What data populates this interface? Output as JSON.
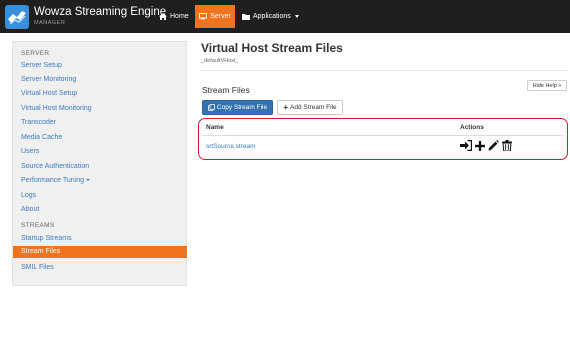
{
  "navbar": {
    "brand_title": "Wowza Streaming Engine",
    "brand_subtitle": "MANAGER",
    "home_label": "Home",
    "server_label": "Server",
    "applications_label": "Applications",
    "active_color": "#f0731f",
    "background_color": "#1f1f1f"
  },
  "sidebar": {
    "server_heading": "SERVER",
    "server_items": [
      "Server Setup",
      "Server Monitoring",
      "Virtual Host Setup",
      "Virtual Host Monitoring",
      "Transcoder",
      "Media Cache",
      "Users",
      "Source Authentication",
      "Performance Tuning",
      "Logs",
      "About"
    ],
    "streams_heading": "STREAMS",
    "streams_items": [
      "Startup Streams",
      "Stream Files",
      "SMIL Files"
    ],
    "active_item": "Stream Files"
  },
  "main": {
    "page_title": "Virtual Host Stream Files",
    "page_subtitle": "_defaultVHost_",
    "hide_help_label": "Hide Help »",
    "section_title": "Stream Files",
    "copy_button_label": "Copy Stream File",
    "add_button_label": "Add Stream File",
    "table": {
      "col_name": "Name",
      "col_actions": "Actions",
      "rows": [
        {
          "name": "srtSource.stream",
          "actions": [
            "connect-icon",
            "plus-icon",
            "pencil-icon",
            "trash-icon"
          ]
        }
      ]
    },
    "highlight_color": "#d0202e",
    "primary_button_color": "#3572b0"
  }
}
